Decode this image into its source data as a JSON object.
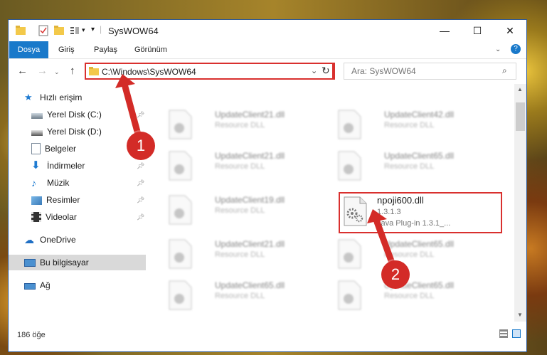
{
  "window": {
    "title": "SysWOW64",
    "minimize": "—",
    "maximize": "☐",
    "close": "✕"
  },
  "ribbon": {
    "tabs": [
      "Dosya",
      "Giriş",
      "Paylaş",
      "Görünüm"
    ],
    "help": "?"
  },
  "address": {
    "path": "C:\\Windows\\SysWOW64",
    "search_placeholder": "Ara: SysWOW64"
  },
  "navpane": {
    "quick_access": "Hızlı erişim",
    "items": [
      "Yerel Disk (C:)",
      "Yerel Disk (D:)",
      "Belgeler",
      "İndirmeler",
      "Müzik",
      "Resimler",
      "Videolar"
    ],
    "onedrive": "OneDrive",
    "this_pc": "Bu bilgisayar",
    "network": "Ağ"
  },
  "files": {
    "left": [
      {
        "name": "UpdateClient21.dll",
        "sub": "Resource DLL"
      },
      {
        "name": "UpdateClient21.dll",
        "sub": "Resource DLL"
      },
      {
        "name": "UpdateClient19.dll",
        "sub": "Resource DLL"
      },
      {
        "name": "UpdateClient21.dll",
        "sub": "Resource DLL"
      },
      {
        "name": "UpdateClient65.dll",
        "sub": "Resource DLL"
      }
    ],
    "right": [
      {
        "name": "UpdateClient42.dll",
        "sub": "Resource DLL"
      },
      {
        "name": "UpdateClient65.dll",
        "sub": "Resource DLL"
      },
      {
        "name": "UpdateClient65.dll",
        "sub": "Resource DLL"
      },
      {
        "name": "UpdateClient65.dll",
        "sub": "Resource DLL"
      }
    ],
    "highlighted": {
      "name": "npoji600.dll",
      "version": "1.3.1.3",
      "desc": "Java Plug-in 1.3.1_..."
    }
  },
  "status": {
    "count": "186 öğe"
  },
  "annotations": {
    "badge1": "1",
    "badge2": "2"
  },
  "colors": {
    "accent": "#1979ca",
    "highlight": "#d9302e"
  }
}
